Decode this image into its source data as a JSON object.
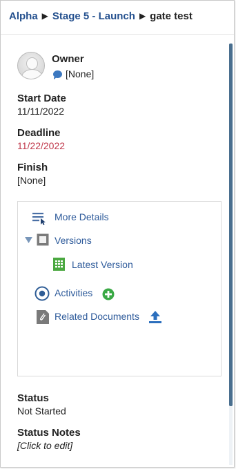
{
  "breadcrumb": {
    "project": "Alpha",
    "stage": "Stage 5 - Launch",
    "current": "gate test",
    "separator": "▶"
  },
  "owner": {
    "label": "Owner",
    "value": "[None]"
  },
  "fields": {
    "start_date_label": "Start Date",
    "start_date_value": "11/11/2022",
    "deadline_label": "Deadline",
    "deadline_value": "11/22/2022",
    "finish_label": "Finish",
    "finish_value": "[None]"
  },
  "panel": {
    "more_details": "More Details",
    "versions": "Versions",
    "latest_version": "Latest Version",
    "activities": "Activities",
    "related_documents": "Related Documents"
  },
  "status": {
    "status_label": "Status",
    "status_value": "Not Started",
    "notes_label": "Status Notes",
    "notes_value": "[Click to edit]"
  },
  "colors": {
    "link": "#2d5a9a",
    "breadcrumb": "#24508e",
    "deadline": "#c0384b",
    "add_green": "#3aa945",
    "sheet_green": "#4aa840",
    "upload_blue": "#2c6fbd"
  },
  "icons": {
    "owner_chat": "chat-bubble-icon",
    "more_details": "details-list-icon",
    "versions_toggle": "caret-down-icon",
    "versions": "versions-box-icon",
    "latest_version": "spreadsheet-icon",
    "activities": "radio-activity-icon",
    "activities_add": "add-circle-icon",
    "related_documents": "paperclip-document-icon",
    "related_documents_upload": "upload-icon"
  }
}
